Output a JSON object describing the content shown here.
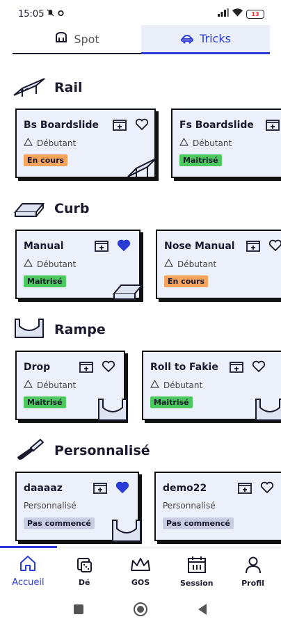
{
  "status_bar": {
    "time": "15:05",
    "battery": "13"
  },
  "top_tabs": [
    {
      "label": "Spot",
      "active": false
    },
    {
      "label": "Tricks",
      "active": true
    }
  ],
  "sections": [
    {
      "title": "Rail",
      "icon": "rail-icon",
      "cards": [
        {
          "name": "Bs Boardslide",
          "level": "Débutant",
          "status": "En cours",
          "favorite": false
        },
        {
          "name": "Fs Boardslide",
          "level": "Débutant",
          "status": "Maitrisé",
          "favorite": false
        }
      ]
    },
    {
      "title": "Curb",
      "icon": "curb-icon",
      "cards": [
        {
          "name": "Manual",
          "level": "Débutant",
          "status": "Maitrisé",
          "favorite": true
        },
        {
          "name": "Nose Manual",
          "level": "Débutant",
          "status": "En cours",
          "favorite": false
        }
      ]
    },
    {
      "title": "Rampe",
      "icon": "ramp-icon",
      "cards": [
        {
          "name": "Drop",
          "level": "Débutant",
          "status": "Maitrisé",
          "favorite": false
        },
        {
          "name": "Roll to Fakie",
          "level": "Débutant",
          "status": "Maitrisé",
          "favorite": false
        }
      ]
    },
    {
      "title": "Personnalisé",
      "icon": "screwdriver-icon",
      "cards": [
        {
          "name": "daaaaz",
          "level": "Personnalisé",
          "status": "Pas commencé",
          "favorite": true
        },
        {
          "name": "demo22",
          "level": "Personnalisé",
          "status": "Pas commencé",
          "favorite": false
        }
      ]
    }
  ],
  "bottom_nav": [
    {
      "label": "Accueil",
      "icon": "home-icon",
      "active": true
    },
    {
      "label": "Dé",
      "icon": "dice-icon",
      "active": false
    },
    {
      "label": "GOS",
      "icon": "crown-icon",
      "active": false
    },
    {
      "label": "Session",
      "icon": "calendar-icon",
      "active": false
    },
    {
      "label": "Profil",
      "icon": "person-icon",
      "active": false
    }
  ],
  "colors": {
    "accent": "#2a3cd6",
    "card_bg": "#ecf0fb",
    "status_en_cours": "#f7a35c",
    "status_maitrise": "#4cc95e",
    "status_pas_commence": "#c9cce0"
  }
}
